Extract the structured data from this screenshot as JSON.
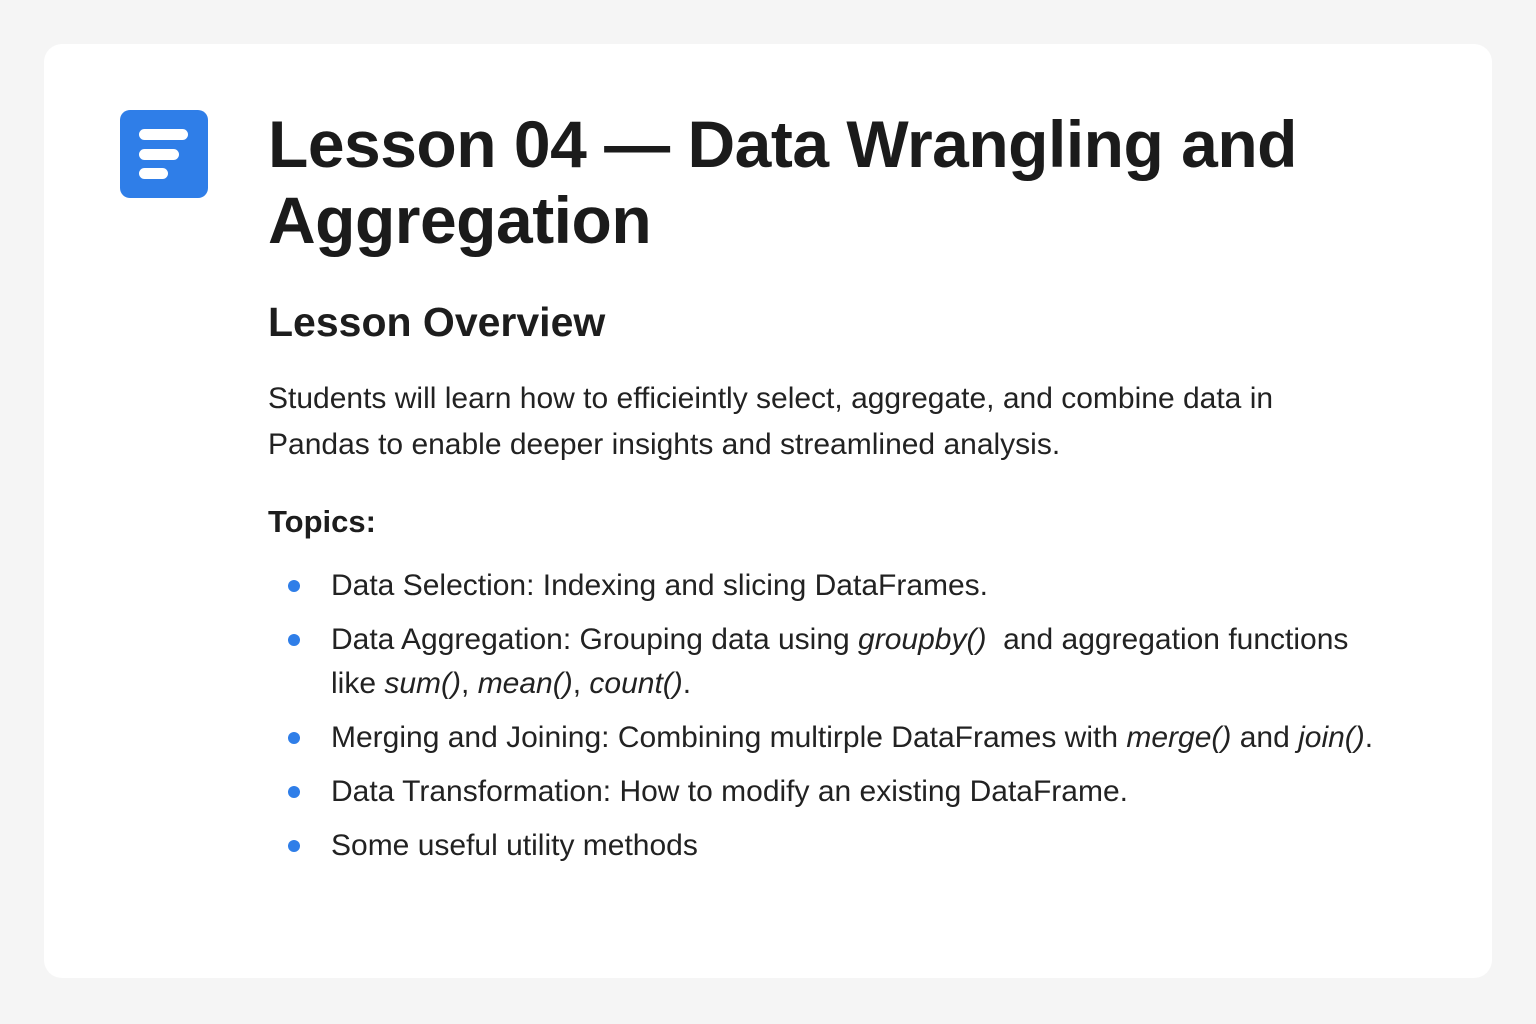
{
  "header": {
    "icon": "document-lines-icon",
    "accent_color": "#2f7ee8",
    "title": "Lesson 04 — Data Wrangling and Aggregation"
  },
  "overview": {
    "heading": "Lesson Overview",
    "text": "Students will learn how to efficieintly select, aggregate, and combine data in Pandas to enable deeper insights and streamlined analysis."
  },
  "topics": {
    "heading": "Topics:",
    "items": [
      {
        "t1": "Data Selection: Indexing and slicing DataFrames."
      },
      {
        "t1": "Data Aggregation: Grouping data using ",
        "c1": "groupby()",
        "t2": "  and aggregation functions like ",
        "c2": "sum()",
        "t3": ", ",
        "c3": "mean()",
        "t4": ", ",
        "c4": "count()",
        "t5": "."
      },
      {
        "t1": "Merging and Joining: Combining multirple DataFrames with ",
        "c1": "merge()",
        "t2": " and ",
        "c2": "join()",
        "t3": "."
      },
      {
        "t1": "Data Transformation: How to modify an existing DataFrame."
      },
      {
        "t1": "Some useful utility methods"
      }
    ]
  }
}
